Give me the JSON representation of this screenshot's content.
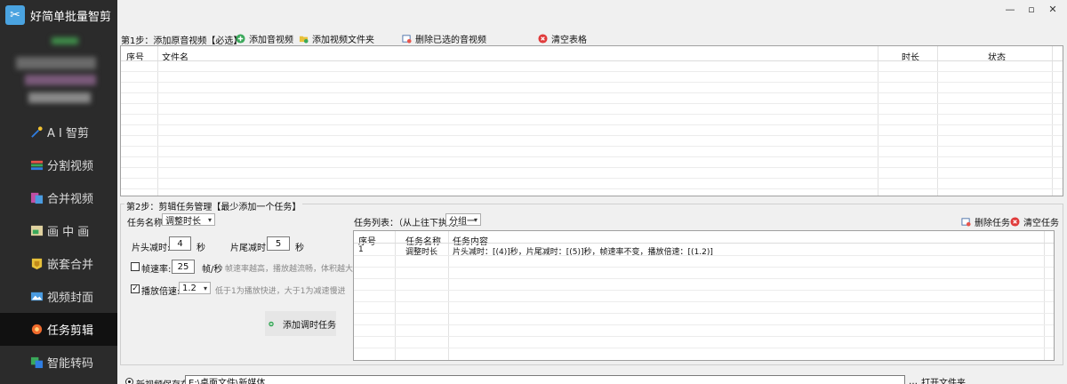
{
  "app": {
    "title": "好简单批量智剪",
    "logo_glyph": "✂"
  },
  "window_controls": {
    "minimize": "—",
    "maximize": "▫",
    "close": "✕"
  },
  "sidebar": {
    "items": [
      {
        "label": "A I 智剪",
        "icon": "ai-wand-icon",
        "color": "#2f7de1"
      },
      {
        "label": "分割视频",
        "icon": "split-film-icon",
        "color": "#e8534a"
      },
      {
        "label": "合并视频",
        "icon": "merge-film-icon",
        "color": "#c04fa3"
      },
      {
        "label": "画 中 画",
        "icon": "picture-in-picture-icon",
        "color": "#e0b04a"
      },
      {
        "label": "嵌套合并",
        "icon": "nest-merge-icon",
        "color": "#e7c13a"
      },
      {
        "label": "视频封面",
        "icon": "video-cover-icon",
        "color": "#4a9be0"
      },
      {
        "label": "任务剪辑",
        "icon": "task-gear-icon",
        "color": "#f06a2c"
      },
      {
        "label": "智能转码",
        "icon": "transcode-icon",
        "color": "#3aa85a"
      }
    ],
    "active_index": 6
  },
  "step1": {
    "title": "第1步：添加原音视频【必选】",
    "add_media": "添加音视频",
    "add_folder": "添加视频文件夹",
    "delete_selected": "删除已选的音视频",
    "clear_table": "清空表格",
    "columns": [
      "序号",
      "文件名",
      "时长",
      "状态"
    ]
  },
  "step2": {
    "title": "第2步：剪辑任务管理【最少添加一个任务】",
    "task_name_label": "任务名称:",
    "task_name_value": "调整时长",
    "head_trim_label": "片头减时:",
    "head_trim_value": "4",
    "head_trim_unit": "秒",
    "tail_trim_label": "片尾减时:",
    "tail_trim_value": "5",
    "tail_trim_unit": "秒",
    "frame_rate_label": "帧速率:",
    "frame_rate_value": "25",
    "frame_rate_unit": "帧/秒",
    "frame_rate_hint": "帧速率越高，播放越流畅，体积越大",
    "frame_rate_checked": false,
    "speed_label": "播放倍速:",
    "speed_value": "1.2",
    "speed_checked": true,
    "speed_hint": "低于1为播放快进，大于1为减速慢进",
    "add_task_button": "添加调时任务",
    "task_list_label": "任务列表：（从上往下执行）",
    "group_value": "分组一",
    "delete_task": "删除任务",
    "clear_tasks": "清空任务",
    "task_columns": [
      "序号",
      "任务名称",
      "任务内容"
    ],
    "tasks": [
      {
        "index": "1",
        "name": "调整时长",
        "content": "片头减时：[(4)]秒，片尾减时：[(5)]秒，帧速率不变，播放倍速：[(1.2)]"
      }
    ]
  },
  "footer": {
    "save_radio_label": "新视频保存在:",
    "save_path": "E:\\桌面文件\\新媒体",
    "open_folder": "打开文件夹"
  }
}
